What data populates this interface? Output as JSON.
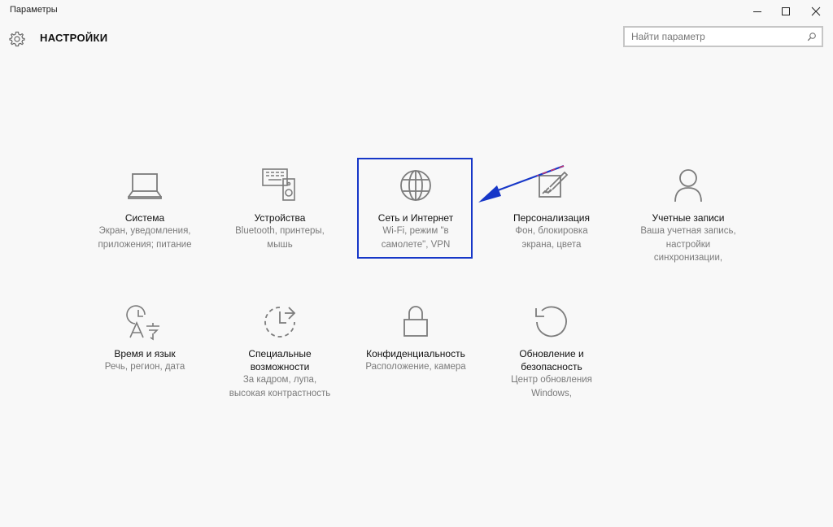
{
  "window": {
    "title": "Параметры"
  },
  "header": {
    "title": "НАСТРОЙКИ",
    "search_placeholder": "Найти параметр"
  },
  "tiles": [
    {
      "name": "Система",
      "desc_lines": [
        "Экран, уведомления,",
        "приложения; питание"
      ],
      "icon": "laptop-icon"
    },
    {
      "name": "Устройства",
      "desc_lines": [
        "Bluetooth, принтеры,",
        "мышь"
      ],
      "icon": "devices-icon"
    },
    {
      "name": "Сеть и Интернет",
      "desc_lines": [
        "Wi-Fi, режим \"в",
        "самолете\", VPN"
      ],
      "icon": "globe-icon"
    },
    {
      "name": "Персонализация",
      "desc_lines": [
        "Фон, блокировка",
        "экрана, цвета"
      ],
      "icon": "paint-icon"
    },
    {
      "name": "Учетные записи",
      "desc_lines": [
        "Ваша учетная запись,",
        "настройки",
        "синхронизации,"
      ],
      "icon": "person-icon"
    },
    {
      "name": "Время и язык",
      "desc_lines": [
        "Речь, регион, дата"
      ],
      "icon": "time-language-icon"
    },
    {
      "name_lines": [
        "Специальные",
        "возможности"
      ],
      "desc_lines": [
        "За кадром, лупа,",
        "высокая контрастность"
      ],
      "icon": "ease-of-access-icon"
    },
    {
      "name": "Конфиденциальность",
      "desc_lines": [
        "Расположение, камера"
      ],
      "icon": "lock-icon"
    },
    {
      "name_lines": [
        "Обновление и",
        "безопасность"
      ],
      "desc_lines": [
        "Центр обновления",
        "Windows,"
      ],
      "icon": "update-icon"
    }
  ],
  "annotation": {
    "highlight_color": "#1737c8",
    "arrow_color": "#1737c8"
  }
}
